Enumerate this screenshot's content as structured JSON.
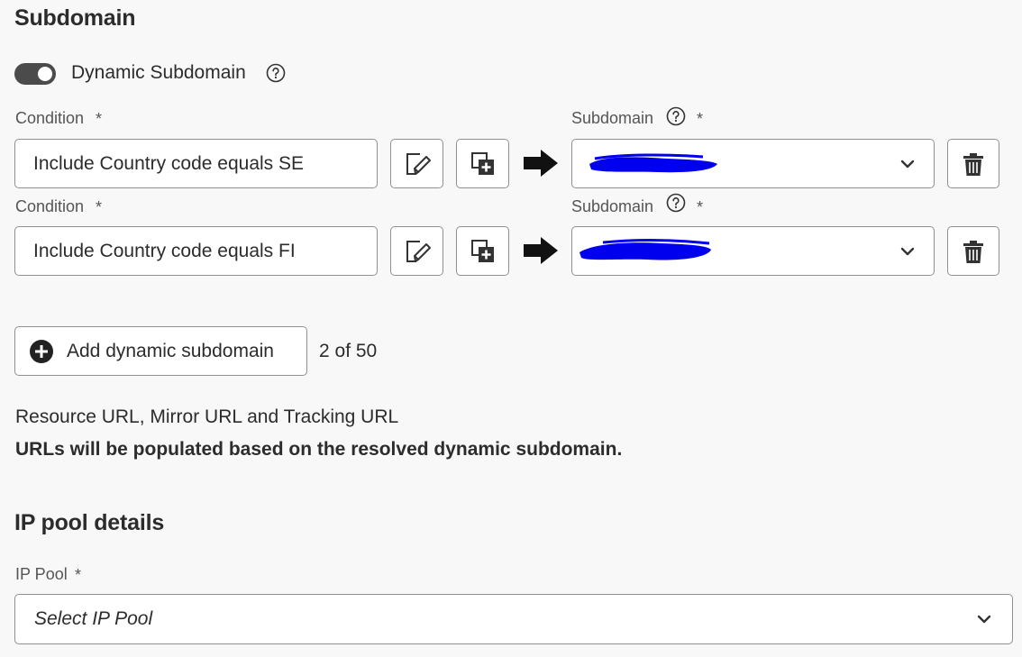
{
  "subdomain_section": {
    "title": "Subdomain",
    "toggle_label": "Dynamic Subdomain",
    "toggle_on": true
  },
  "rows": [
    {
      "condition_label": "Condition",
      "condition_value": "Include Country code equals SE",
      "subdomain_label": "Subdomain",
      "required_mark": "*"
    },
    {
      "condition_label": "Condition",
      "condition_value": "Include Country code equals FI",
      "subdomain_label": "Subdomain",
      "required_mark": "*"
    }
  ],
  "add_button": {
    "label": "Add dynamic subdomain"
  },
  "counter": "2 of 50",
  "urls": {
    "title": "Resource URL, Mirror URL and Tracking URL",
    "note": "URLs will be populated based on the resolved dynamic subdomain."
  },
  "ip_pool_section": {
    "title": "IP pool details",
    "field_label": "IP Pool",
    "required_mark": "*",
    "placeholder": "Select IP Pool"
  },
  "colors": {
    "redaction": "#0000ee",
    "toggle_on": "#4b4b4b",
    "border": "#909090"
  }
}
